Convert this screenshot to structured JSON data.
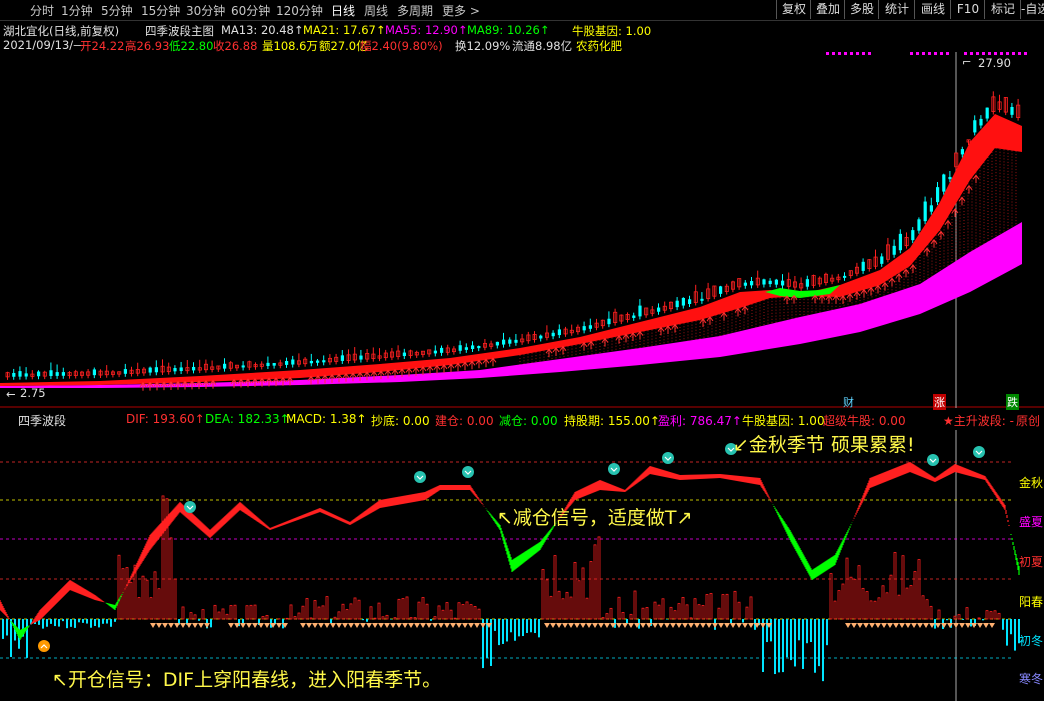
{
  "toolbar": {
    "tabs": [
      "分时",
      "1分钟",
      "5分钟",
      "15分钟",
      "30分钟",
      "60分钟",
      "120分钟",
      "日线",
      "周线",
      "多周期",
      "更多 >"
    ],
    "active_tab": "日线",
    "right_buttons": [
      "复权",
      "叠加",
      "多股",
      "统计",
      "画线",
      "F10",
      "标记",
      "-自选"
    ]
  },
  "header": {
    "stock_name": "湖北宜化(日线,前复权)",
    "indicator_name": "四季波段主图",
    "ma13": "MA13: 20.48↑",
    "ma21": "MA21: 17.67↑",
    "ma55": "MA55: 12.90↑",
    "ma89": "MA89: 10.26↑",
    "gene": "牛股基因: 1.00",
    "date": "2021/09/13/—",
    "open": "开24.22",
    "high": "高26.93",
    "low": "低22.80",
    "close": "收26.88",
    "volume": "量108.6万",
    "amount": "额27.0亿",
    "change": "幅2.40(9.80%)",
    "turnover": "换12.09%",
    "float_cap": "流通8.98亿",
    "sector": "农药化肥"
  },
  "main_chart": {
    "max_label": "27.90",
    "min_label": "2.75",
    "markers": [
      "财",
      "涨",
      "跌"
    ]
  },
  "sub_panel": {
    "title": "四季波段",
    "dif": "DIF: 193.60↑",
    "dea": "DEA: 182.33↑",
    "macd": "MACD: 1.38↑",
    "chaodi": "抄底: 0.00",
    "jiancang": "建仓: 0.00",
    "jiancang2": "减仓: 0.00",
    "chigu": "持股期: 155.00↑",
    "yingli": "盈利: 786.47↑",
    "gene": "牛股基因: 1.00",
    "super": "超级牛股: 0.00",
    "wave": "★主升波段: -",
    "original": "原创",
    "level_labels": [
      "金秋",
      "盛夏",
      "初夏",
      "阳春",
      "初冬",
      "寒冬"
    ]
  },
  "annotations": {
    "autumn": "↙金秋季节 硕果累累!",
    "reduce": "↖减仓信号，适度做T↗",
    "open": "↖开仓信号：DIF上穿阳春线，进入阳春季节。"
  },
  "colors": {
    "up": "#ff2020",
    "down": "#00ff00",
    "magenta": "#ff00ff",
    "cyan": "#00e5ff",
    "yellow": "#ffff00",
    "grid": "#a00000"
  }
}
